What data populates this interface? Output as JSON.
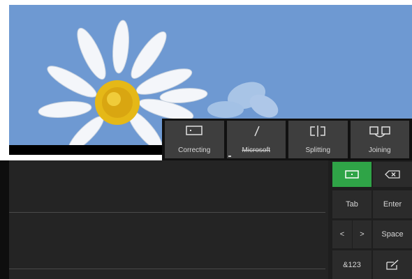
{
  "gestures": [
    {
      "label": "Correcting",
      "icon": "correcting-icon",
      "strike": false
    },
    {
      "label": "Microsoft",
      "icon": "strikethrough-slash-icon",
      "strike": true
    },
    {
      "label": "Splitting",
      "icon": "splitting-icon",
      "strike": false
    },
    {
      "label": "Joining",
      "icon": "joining-icon",
      "strike": false
    }
  ],
  "keys": {
    "insert_label": "",
    "backspace_label": "",
    "tab_label": "Tab",
    "enter_label": "Enter",
    "left_label": "<",
    "right_label": ">",
    "space_label": "Space",
    "symbols_label": "&123",
    "keyboard_switch_label": ""
  },
  "colors": {
    "wallpaper_sky": "#6e99d2",
    "accent_green": "#2fa447",
    "panel_bg": "#1e1e1e",
    "key_bg": "#2b2b2b"
  }
}
